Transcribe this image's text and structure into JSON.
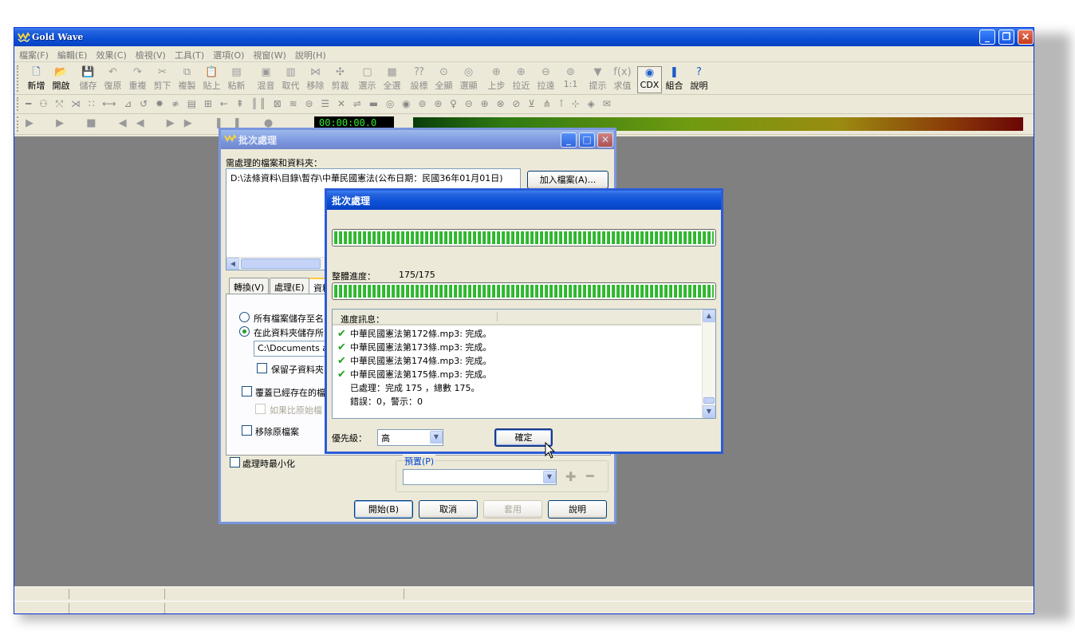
{
  "app": {
    "title": "Gold Wave",
    "menu": [
      "檔案(F)",
      "編輯(E)",
      "效果(C)",
      "檢視(V)",
      "工具(T)",
      "選項(O)",
      "視窗(W)",
      "說明(H)"
    ],
    "toolbar": [
      {
        "label": "新增",
        "icon": "new-file-icon",
        "glyph": "🗋"
      },
      {
        "label": "開啟",
        "icon": "open-folder-icon",
        "glyph": "📂"
      },
      {
        "label": "儲存",
        "icon": "save-icon",
        "glyph": "💾"
      },
      {
        "label": "復原",
        "icon": "undo-icon",
        "glyph": "↶"
      },
      {
        "label": "重複",
        "icon": "redo-icon",
        "glyph": "↷"
      },
      {
        "label": "剪下",
        "icon": "cut-icon",
        "glyph": "✂"
      },
      {
        "label": "複製",
        "icon": "copy-icon",
        "glyph": "⧉"
      },
      {
        "label": "貼上",
        "icon": "paste-icon",
        "glyph": "📋"
      },
      {
        "label": "粘新",
        "icon": "paste-new-icon",
        "glyph": "▤"
      },
      {
        "label": "混音",
        "icon": "mix-icon",
        "glyph": "▣"
      },
      {
        "label": "取代",
        "icon": "replace-icon",
        "glyph": "▥"
      },
      {
        "label": "移除",
        "icon": "delete-icon",
        "glyph": "⋈"
      },
      {
        "label": "剪裁",
        "icon": "trim-icon",
        "glyph": "✣"
      },
      {
        "label": "選示",
        "icon": "select-view-icon",
        "glyph": "▢"
      },
      {
        "label": "全選",
        "icon": "select-all-icon",
        "glyph": "▦"
      },
      {
        "label": "設標",
        "icon": "set-marker-icon",
        "glyph": "⁇"
      },
      {
        "label": "全顯",
        "icon": "show-all-icon",
        "glyph": "⊙"
      },
      {
        "label": "選顯",
        "icon": "show-selection-icon",
        "glyph": "◎"
      },
      {
        "label": "上步",
        "icon": "previous-zoom-icon",
        "glyph": "⊕"
      },
      {
        "label": "拉近",
        "icon": "zoom-in-icon",
        "glyph": "⊕"
      },
      {
        "label": "拉遠",
        "icon": "zoom-out-icon",
        "glyph": "⊖"
      },
      {
        "label": "1:1",
        "icon": "zoom-1-1-icon",
        "glyph": "⊚"
      },
      {
        "label": "提示",
        "icon": "cue-icon",
        "glyph": "▼"
      },
      {
        "label": "求值",
        "icon": "evaluate-icon",
        "glyph": "f(x)"
      },
      {
        "label": "CDX",
        "icon": "cd-extract-icon",
        "glyph": "◉"
      },
      {
        "label": "組合",
        "icon": "combine-icon",
        "glyph": "❚"
      },
      {
        "label": "說明",
        "icon": "help-icon",
        "glyph": "?"
      }
    ],
    "timer": "00:00:00.0"
  },
  "batch_dialog": {
    "title": "批次處理",
    "files_label": "需處理的檔案和資料夾：",
    "file_item": "D:\\法條資料\\目錄\\暫存\\中華民國憲法(公布日期：民國36年01月01日)",
    "add_files_button": "加入檔案(A)...",
    "tabs": [
      "轉換(V)",
      "處理(E)",
      "資料"
    ],
    "option_save_all": "所有檔案儲存至名",
    "option_save_here": "在此資料夾儲存所",
    "save_path": "C:\\Documents and",
    "keep_subfolders": "保留子資料夾",
    "overwrite_existing": "覆蓋已經存在的檔",
    "if_newer": "如果比原始檔",
    "remove_original": "移除原檔案",
    "minimize_while_processing": "處理時最小化",
    "preset_group": "預置(P)",
    "buttons": {
      "start": "開始(B)",
      "cancel": "取消",
      "apply": "套用",
      "help": "說明"
    }
  },
  "progress_dialog": {
    "title": "批次處理",
    "file_progress_fraction": 1.0,
    "overall_label": "整體進度：",
    "overall_count": "175/175",
    "overall_progress_fraction": 1.0,
    "log_header": "進度訊息：",
    "log_lines": [
      {
        "check": true,
        "text": "中華民國憲法第172條.mp3: 完成。"
      },
      {
        "check": true,
        "text": "中華民國憲法第173條.mp3: 完成。"
      },
      {
        "check": true,
        "text": "中華民國憲法第174條.mp3: 完成。"
      },
      {
        "check": true,
        "text": "中華民國憲法第175條.mp3: 完成。"
      },
      {
        "check": false,
        "text": "已處理：完成 175 ，總數 175。"
      },
      {
        "check": false,
        "text": "錯誤：0，警示：0"
      }
    ],
    "priority_label": "優先級：",
    "priority_value": "高",
    "ok_button": "確定"
  },
  "colors": {
    "titlebar": "#0a4fd6",
    "workspace": "#808080",
    "progress": "#2aaa2a"
  }
}
